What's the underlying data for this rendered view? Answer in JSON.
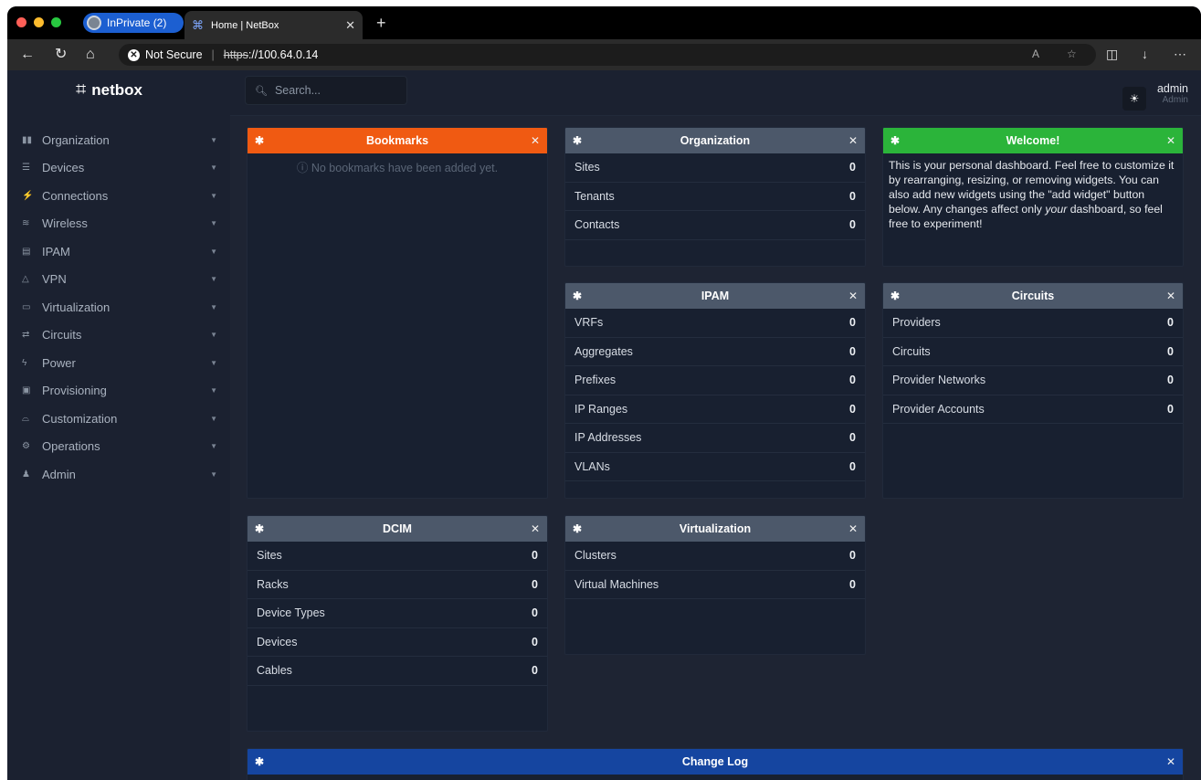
{
  "browser": {
    "inprivate_label": "InPrivate (2)",
    "tab_title": "Home | NetBox",
    "security_label": "Not Secure",
    "url_scheme": "https",
    "url_rest": "://100.64.0.14"
  },
  "brand": {
    "name": "netbox"
  },
  "sidebar": {
    "items": [
      {
        "label": "Organization",
        "icon": "org-icon"
      },
      {
        "label": "Devices",
        "icon": "server-icon"
      },
      {
        "label": "Connections",
        "icon": "plug-icon"
      },
      {
        "label": "Wireless",
        "icon": "wifi-icon"
      },
      {
        "label": "IPAM",
        "icon": "ip-icon"
      },
      {
        "label": "VPN",
        "icon": "vpn-icon"
      },
      {
        "label": "Virtualization",
        "icon": "monitor-icon"
      },
      {
        "label": "Circuits",
        "icon": "circuit-icon"
      },
      {
        "label": "Power",
        "icon": "power-icon"
      },
      {
        "label": "Provisioning",
        "icon": "clipboard-icon"
      },
      {
        "label": "Customization",
        "icon": "palette-icon"
      },
      {
        "label": "Operations",
        "icon": "cogs-icon"
      },
      {
        "label": "Admin",
        "icon": "users-icon"
      }
    ]
  },
  "header": {
    "search_placeholder": "Search...",
    "user_name": "admin",
    "user_role": "Admin"
  },
  "widgets": {
    "bookmarks": {
      "title": "Bookmarks",
      "empty": "ⓘ No bookmarks have been added yet."
    },
    "organization": {
      "title": "Organization",
      "rows": [
        {
          "label": "Sites",
          "count": "0"
        },
        {
          "label": "Tenants",
          "count": "0"
        },
        {
          "label": "Contacts",
          "count": "0"
        }
      ]
    },
    "welcome": {
      "title": "Welcome!",
      "text_a": "This is your personal dashboard. Feel free to customize it by rearranging, resizing, or removing widgets. You can also add new widgets using the \"add widget\" button below. Any changes affect only ",
      "text_em": "your",
      "text_b": " dashboard, so feel free to experiment!"
    },
    "ipam": {
      "title": "IPAM",
      "rows": [
        {
          "label": "VRFs",
          "count": "0"
        },
        {
          "label": "Aggregates",
          "count": "0"
        },
        {
          "label": "Prefixes",
          "count": "0"
        },
        {
          "label": "IP Ranges",
          "count": "0"
        },
        {
          "label": "IP Addresses",
          "count": "0"
        },
        {
          "label": "VLANs",
          "count": "0"
        }
      ]
    },
    "circuits": {
      "title": "Circuits",
      "rows": [
        {
          "label": "Providers",
          "count": "0"
        },
        {
          "label": "Circuits",
          "count": "0"
        },
        {
          "label": "Provider Networks",
          "count": "0"
        },
        {
          "label": "Provider Accounts",
          "count": "0"
        }
      ]
    },
    "dcim": {
      "title": "DCIM",
      "rows": [
        {
          "label": "Sites",
          "count": "0"
        },
        {
          "label": "Racks",
          "count": "0"
        },
        {
          "label": "Device Types",
          "count": "0"
        },
        {
          "label": "Devices",
          "count": "0"
        },
        {
          "label": "Cables",
          "count": "0"
        }
      ]
    },
    "virtualization": {
      "title": "Virtualization",
      "rows": [
        {
          "label": "Clusters",
          "count": "0"
        },
        {
          "label": "Virtual Machines",
          "count": "0"
        }
      ]
    },
    "changelog": {
      "title": "Change Log"
    }
  },
  "colors": {
    "bookmarks_header": "#f05a12",
    "welcome_header": "#2bb43a",
    "changelog_header": "#1545a0",
    "default_header": "#4c586a"
  }
}
